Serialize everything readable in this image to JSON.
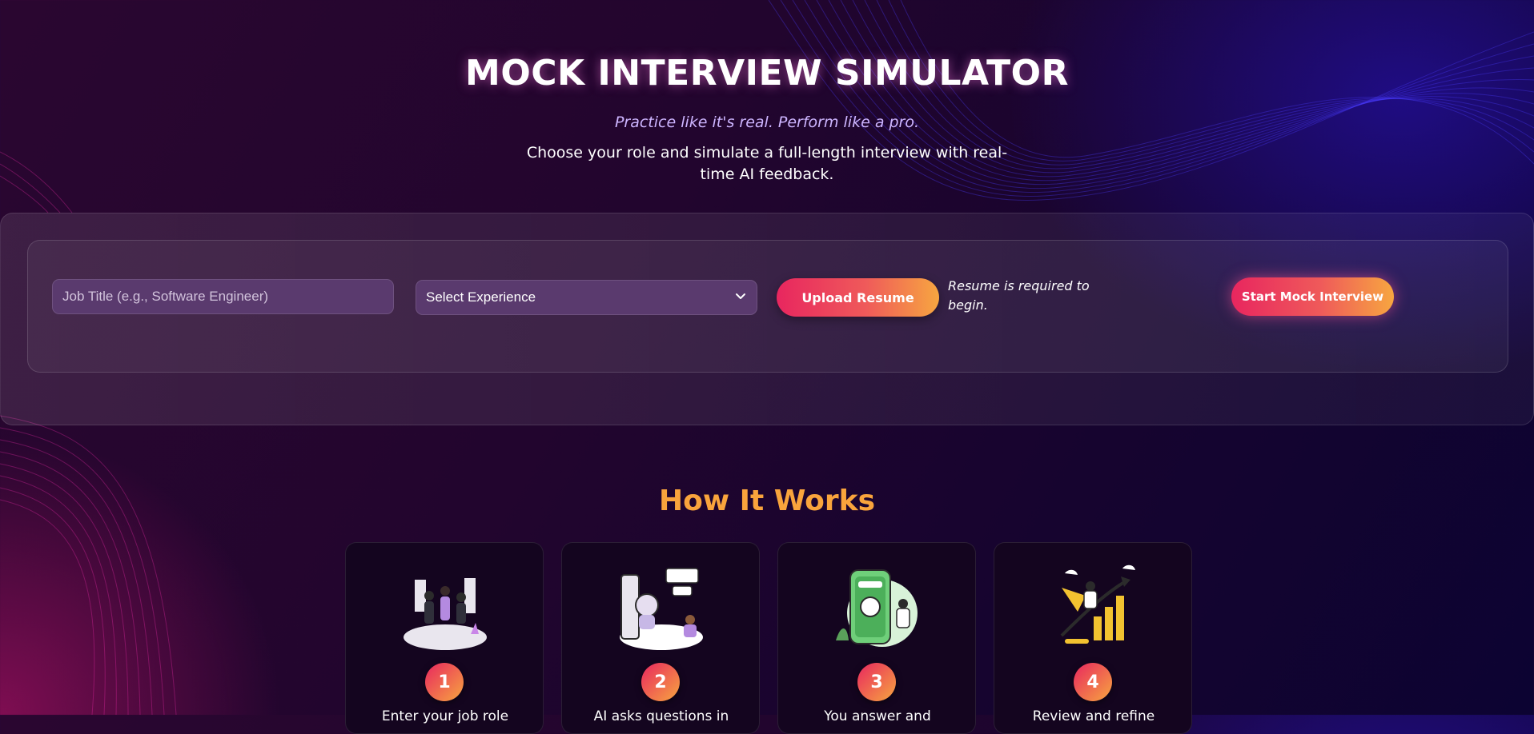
{
  "hero": {
    "title": "MOCK INTERVIEW SIMULATOR",
    "tagline": "Practice like it's real. Perform like a pro.",
    "description": "Choose your role and simulate a full-length interview with real-time AI feedback."
  },
  "form": {
    "job_title_placeholder": "Job Title (e.g., Software Engineer)",
    "experience_selected": "Select Experience",
    "upload_label": "Upload Resume",
    "resume_note": "Resume is required to begin.",
    "start_label": "Start Mock Interview"
  },
  "how_it_works": {
    "title": "How It Works",
    "steps": [
      {
        "number": "1",
        "text": "Enter your job role"
      },
      {
        "number": "2",
        "text": "AI asks questions in"
      },
      {
        "number": "3",
        "text": "You answer and"
      },
      {
        "number": "4",
        "text": "Review and refine"
      }
    ]
  },
  "colors": {
    "accent_start": "#e8265f",
    "accent_end": "#f7a640",
    "heading_orange": "#f9a43c",
    "tagline_lilac": "#cdb5ff"
  },
  "icons": [
    "chevron-down-icon",
    "team-walking-illustration",
    "ai-robot-chat-illustration",
    "mobile-feedback-illustration",
    "growth-chart-illustration"
  ]
}
